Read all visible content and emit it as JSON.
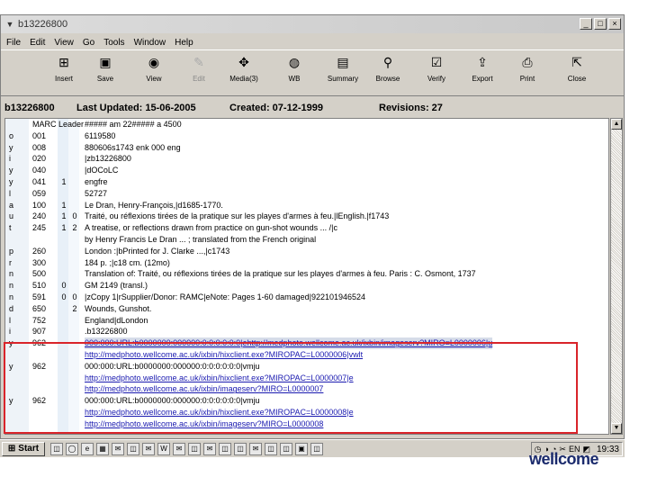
{
  "window": {
    "title": "b13226800",
    "controls": {
      "minimize": "_",
      "maximize": "□",
      "close": "×"
    }
  },
  "menu": [
    "File",
    "Edit",
    "View",
    "Go",
    "Tools",
    "Window",
    "Help"
  ],
  "toolbar": [
    {
      "label": "Insert",
      "icon": "insert-icon",
      "glyph": "⊞",
      "disabled": false
    },
    {
      "label": "Save",
      "icon": "save-icon",
      "glyph": "▣",
      "disabled": false
    },
    {
      "label": "View",
      "icon": "view-icon",
      "glyph": "◉",
      "disabled": false
    },
    {
      "label": "Edit",
      "icon": "edit-icon",
      "glyph": "✎",
      "disabled": true
    },
    {
      "label": "Media(3)",
      "icon": "media-icon",
      "glyph": "✥",
      "disabled": false
    },
    {
      "label": "WB",
      "icon": "web-icon",
      "glyph": "◍",
      "disabled": false
    },
    {
      "label": "Summary",
      "icon": "summary-icon",
      "glyph": "▤",
      "disabled": false
    },
    {
      "label": "Browse",
      "icon": "browse-icon",
      "glyph": "⚲",
      "disabled": false
    },
    {
      "label": "Verify",
      "icon": "verify-icon",
      "glyph": "☑",
      "disabled": false
    },
    {
      "label": "Export",
      "icon": "export-icon",
      "glyph": "⇪",
      "disabled": false
    },
    {
      "label": "Print",
      "icon": "print-icon",
      "glyph": "⎙",
      "disabled": false
    },
    {
      "label": "Close",
      "icon": "close-icon",
      "glyph": "⇱",
      "disabled": false
    }
  ],
  "record_header": {
    "record_id": "b13226800",
    "last_updated": "Last Updated: 15-06-2005",
    "created": "Created: 07-12-1999",
    "revisions": "Revisions: 27"
  },
  "marc_rows": [
    {
      "label": "",
      "tag": "MARC Leader",
      "ind1": "",
      "ind2": "",
      "text": "##### am  22##### a 4500",
      "is_link": false,
      "selected": false
    },
    {
      "label": "o",
      "tag": "001",
      "ind1": "",
      "ind2": "",
      "text": "6119580",
      "is_link": false,
      "selected": false
    },
    {
      "label": "y",
      "tag": "008",
      "ind1": "",
      "ind2": "",
      "text": "880606s1743    enk         000  eng",
      "is_link": false,
      "selected": false
    },
    {
      "label": "i",
      "tag": "020",
      "ind1": "",
      "ind2": "",
      "text": "|zb13226800",
      "is_link": false,
      "selected": false
    },
    {
      "label": "y",
      "tag": "040",
      "ind1": "",
      "ind2": "",
      "text": "|dOCoLC",
      "is_link": false,
      "selected": false
    },
    {
      "label": "y",
      "tag": "041",
      "ind1": "1",
      "ind2": "",
      "text": "engfre",
      "is_link": false,
      "selected": false
    },
    {
      "label": "l",
      "tag": "059",
      "ind1": "",
      "ind2": "",
      "text": "52727",
      "is_link": false,
      "selected": false
    },
    {
      "label": "a",
      "tag": "100",
      "ind1": "1",
      "ind2": "",
      "text": "Le Dran, Henry-François,|d1685-1770.",
      "is_link": false,
      "selected": false
    },
    {
      "label": "u",
      "tag": "240",
      "ind1": "1",
      "ind2": "0",
      "text": "Traité, ou réflexions tirées de la pratique sur les playes d'armes à feu.|lEnglish.|f1743",
      "is_link": false,
      "selected": false
    },
    {
      "label": "t",
      "tag": "245",
      "ind1": "1",
      "ind2": "2",
      "text": "A treatise, or reflections drawn from practice on gun-shot wounds ... /|c",
      "is_link": false,
      "selected": false
    },
    {
      "label": "",
      "tag": "",
      "ind1": "",
      "ind2": "",
      "text": "by Henry Francis Le Dran ... ; translated from the French original",
      "is_link": false,
      "selected": false
    },
    {
      "label": "p",
      "tag": "260",
      "ind1": "",
      "ind2": "",
      "text": "London :|bPrinted for J. Clarke ...,|c1743",
      "is_link": false,
      "selected": false
    },
    {
      "label": "r",
      "tag": "300",
      "ind1": "",
      "ind2": "",
      "text": "184 p. ;|c18 cm. (12mo)",
      "is_link": false,
      "selected": false
    },
    {
      "label": "n",
      "tag": "500",
      "ind1": "",
      "ind2": "",
      "text": "Translation of: Traité, ou réflexions tirées de la pratique sur les playes d'armes à feu. Paris : C. Osmont, 1737",
      "is_link": false,
      "selected": false
    },
    {
      "label": "n",
      "tag": "510",
      "ind1": "0",
      "ind2": "",
      "text": "GM 2149 (transl.)",
      "is_link": false,
      "selected": false
    },
    {
      "label": "n",
      "tag": "591",
      "ind1": "0",
      "ind2": "0",
      "text": "|zCopy 1|rSupplier/Donor: RAMC|eNote: Pages 1-60 damaged|922101946524",
      "is_link": false,
      "selected": false
    },
    {
      "label": "d",
      "tag": "650",
      "ind1": "",
      "ind2": "2",
      "text": "Wounds, Gunshot.",
      "is_link": false,
      "selected": false
    },
    {
      "label": "l",
      "tag": "752",
      "ind1": "",
      "ind2": "",
      "text": "England|dLondon",
      "is_link": false,
      "selected": false
    },
    {
      "label": "i",
      "tag": "907",
      "ind1": "",
      "ind2": "",
      "text": ".b13226800",
      "is_link": false,
      "selected": false
    },
    {
      "label": "y",
      "tag": "962",
      "ind1": "",
      "ind2": "",
      "text": "000:000:URL:b0000000:000000:0:0:0:0:0:0|ehttp://medphoto.wellcome.ac.uk/ixbin/imageserv?MIRO=L0000006|u",
      "is_link": true,
      "selected": true
    },
    {
      "label": "",
      "tag": "",
      "ind1": "",
      "ind2": "",
      "text": "http://medphoto.wellcome.ac.uk/ixbin/hixclient.exe?MIROPAC=L0000006|vwlt",
      "is_link": true,
      "selected": false
    },
    {
      "label": "y",
      "tag": "962",
      "ind1": "",
      "ind2": "",
      "text": "000:000:URL:b0000000:000000:0:0:0:0:0:0|vmju",
      "is_link": false,
      "selected": false
    },
    {
      "label": "",
      "tag": "",
      "ind1": "",
      "ind2": "",
      "text": "http://medphoto.wellcome.ac.uk/ixbin/hixclient.exe?MIROPAC=L0000007|e",
      "is_link": true,
      "selected": false
    },
    {
      "label": "",
      "tag": "",
      "ind1": "",
      "ind2": "",
      "text": "http://medphoto.wellcome.ac.uk/ixbin/imageserv?MIRO=L0000007",
      "is_link": true,
      "selected": false
    },
    {
      "label": "y",
      "tag": "962",
      "ind1": "",
      "ind2": "",
      "text": "000:000:URL:b0000000:000000:0:0:0:0:0:0|vmju",
      "is_link": false,
      "selected": false
    },
    {
      "label": "",
      "tag": "",
      "ind1": "",
      "ind2": "",
      "text": "http://medphoto.wellcome.ac.uk/ixbin/hixclient.exe?MIROPAC=L0000008|e",
      "is_link": true,
      "selected": false
    },
    {
      "label": "",
      "tag": "",
      "ind1": "",
      "ind2": "",
      "text": "http://medphoto.wellcome.ac.uk/ixbin/imageserv?MIRO=L0000008",
      "is_link": true,
      "selected": false
    }
  ],
  "taskbar": {
    "start_label": "Start",
    "clock": "19:33",
    "quick_icons": [
      "◫",
      "◯",
      "e",
      "▦",
      "✉",
      "◫",
      "✉",
      "W",
      "✉",
      "◫",
      "✉",
      "◫",
      "◫",
      "✉",
      "◫",
      "◫",
      "▣",
      "◫"
    ],
    "tray_icons": [
      "◷",
      "◑",
      "◔",
      "✂",
      "EN",
      "◩"
    ]
  },
  "brand": {
    "text": "wellcome"
  },
  "colors": {
    "highlight_box": "#d9242a",
    "link": "#1a1ab0",
    "brand": "#1a2a6c"
  }
}
